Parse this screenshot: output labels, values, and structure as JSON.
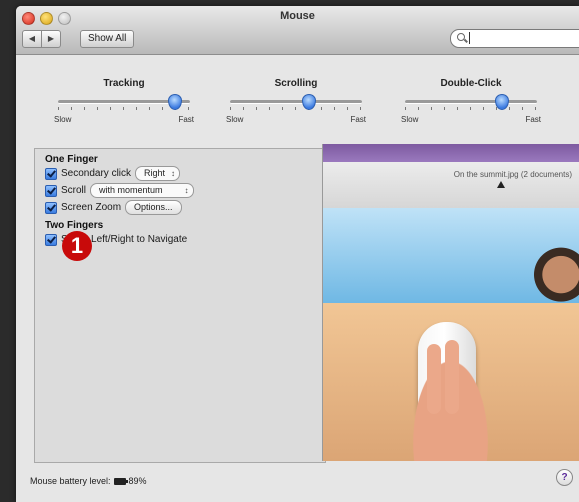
{
  "window": {
    "title": "Mouse",
    "show_all_label": "Show All",
    "search_placeholder": ""
  },
  "sliders": [
    {
      "label": "Tracking",
      "min_label": "Slow",
      "max_label": "Fast",
      "level": 0.92
    },
    {
      "label": "Scrolling",
      "min_label": "Slow",
      "max_label": "Fast",
      "level": 0.6
    },
    {
      "label": "Double-Click",
      "min_label": "Slow",
      "max_label": "Fast",
      "level": 0.75
    }
  ],
  "one_finger": {
    "title": "One Finger",
    "secondary_click_label": "Secondary click",
    "secondary_click_value": "Right",
    "scroll_label": "Scroll",
    "scroll_value": "with momentum",
    "screen_zoom_label": "Screen Zoom",
    "options_label": "Options..."
  },
  "two_fingers": {
    "title": "Two Fingers",
    "swipe_label": "Swipe Left/Right to Navigate"
  },
  "annotation_badge": "1",
  "preview": {
    "finder_text": "On the summit.jpg (2 documents)"
  },
  "status": {
    "battery_label": "Mouse battery level:",
    "battery_value": "89%"
  },
  "help_label": "?"
}
